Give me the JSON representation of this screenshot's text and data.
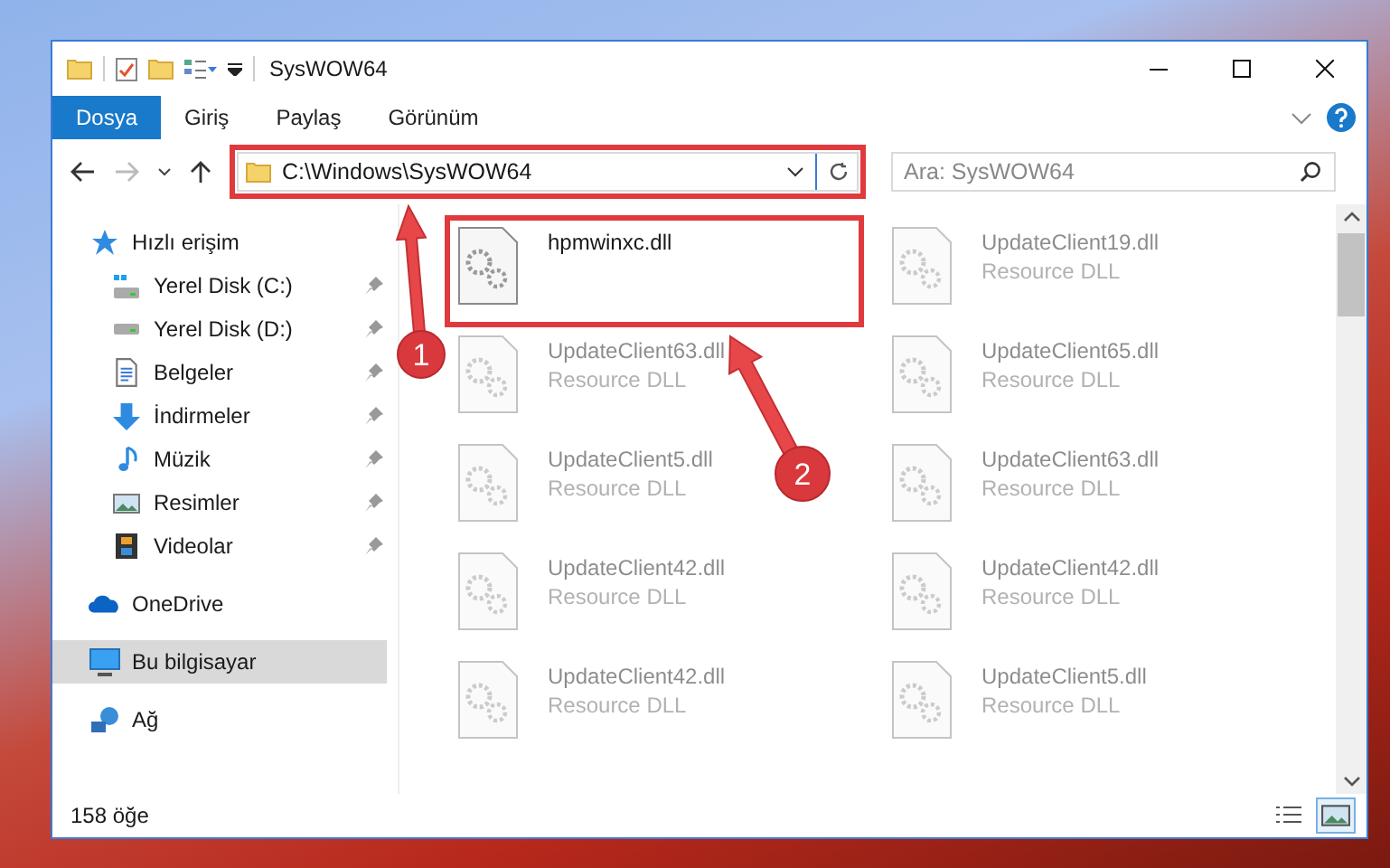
{
  "window": {
    "title": "SysWOW64"
  },
  "ribbon_tabs": [
    {
      "label": "Dosya",
      "kind": "file_menu"
    },
    {
      "label": "Giriş",
      "kind": "tab"
    },
    {
      "label": "Paylaş",
      "kind": "tab"
    },
    {
      "label": "Görünüm",
      "kind": "tab"
    }
  ],
  "address_bar": {
    "path": "C:\\Windows\\SysWOW64",
    "highlighted": true
  },
  "search": {
    "placeholder": "Ara: SysWOW64"
  },
  "navigation": [
    {
      "label": "Hızlı erişim",
      "kind": "quick_access",
      "selected": false,
      "children": [
        {
          "label": "Yerel Disk (C:)",
          "kind": "system_drive",
          "pinned": true,
          "selected": false
        },
        {
          "label": "Yerel Disk (D:)",
          "kind": "drive",
          "pinned": true,
          "selected": false
        },
        {
          "label": "Belgeler",
          "kind": "documents",
          "pinned": true,
          "selected": false
        },
        {
          "label": "İndirmeler",
          "kind": "downloads",
          "pinned": true,
          "selected": false
        },
        {
          "label": "Müzik",
          "kind": "music",
          "pinned": true,
          "selected": false
        },
        {
          "label": "Resimler",
          "kind": "pictures",
          "pinned": true,
          "selected": false
        },
        {
          "label": "Videolar",
          "kind": "videos",
          "pinned": true,
          "selected": false
        }
      ]
    },
    {
      "label": "OneDrive",
      "kind": "cloud",
      "selected": false
    },
    {
      "label": "Bu bilgisayar",
      "kind": "computer",
      "selected": true
    },
    {
      "label": "Ağ",
      "kind": "network",
      "selected": false
    }
  ],
  "files": [
    {
      "name": "hpmwinxc.dll",
      "highlighted": true,
      "blurred": false
    },
    {
      "name": "UpdateClient19.dll",
      "type": "Resource DLL",
      "highlighted": false,
      "blurred": true
    },
    {
      "name": "UpdateClient63.dll",
      "type": "Resource DLL",
      "highlighted": false,
      "blurred": true
    },
    {
      "name": "UpdateClient65.dll",
      "type": "Resource DLL",
      "highlighted": false,
      "blurred": true
    },
    {
      "name": "UpdateClient5.dll",
      "type": "Resource DLL",
      "highlighted": false,
      "blurred": true
    },
    {
      "name": "UpdateClient63.dll",
      "type": "Resource DLL",
      "highlighted": false,
      "blurred": true
    },
    {
      "name": "UpdateClient42.dll",
      "type": "Resource DLL",
      "highlighted": false,
      "blurred": true
    },
    {
      "name": "UpdateClient42.dll",
      "type": "Resource DLL",
      "highlighted": false,
      "blurred": true
    },
    {
      "name": "UpdateClient42.dll",
      "type": "Resource DLL",
      "highlighted": false,
      "blurred": true
    },
    {
      "name": "UpdateClient5.dll",
      "type": "Resource DLL",
      "highlighted": false,
      "blurred": true
    }
  ],
  "status_bar": {
    "item_count": "158 öğe",
    "views": [
      {
        "kind": "details",
        "selected": false
      },
      {
        "kind": "large_icons",
        "selected": true
      }
    ]
  },
  "callouts": [
    {
      "number": "1"
    },
    {
      "number": "2"
    }
  ]
}
